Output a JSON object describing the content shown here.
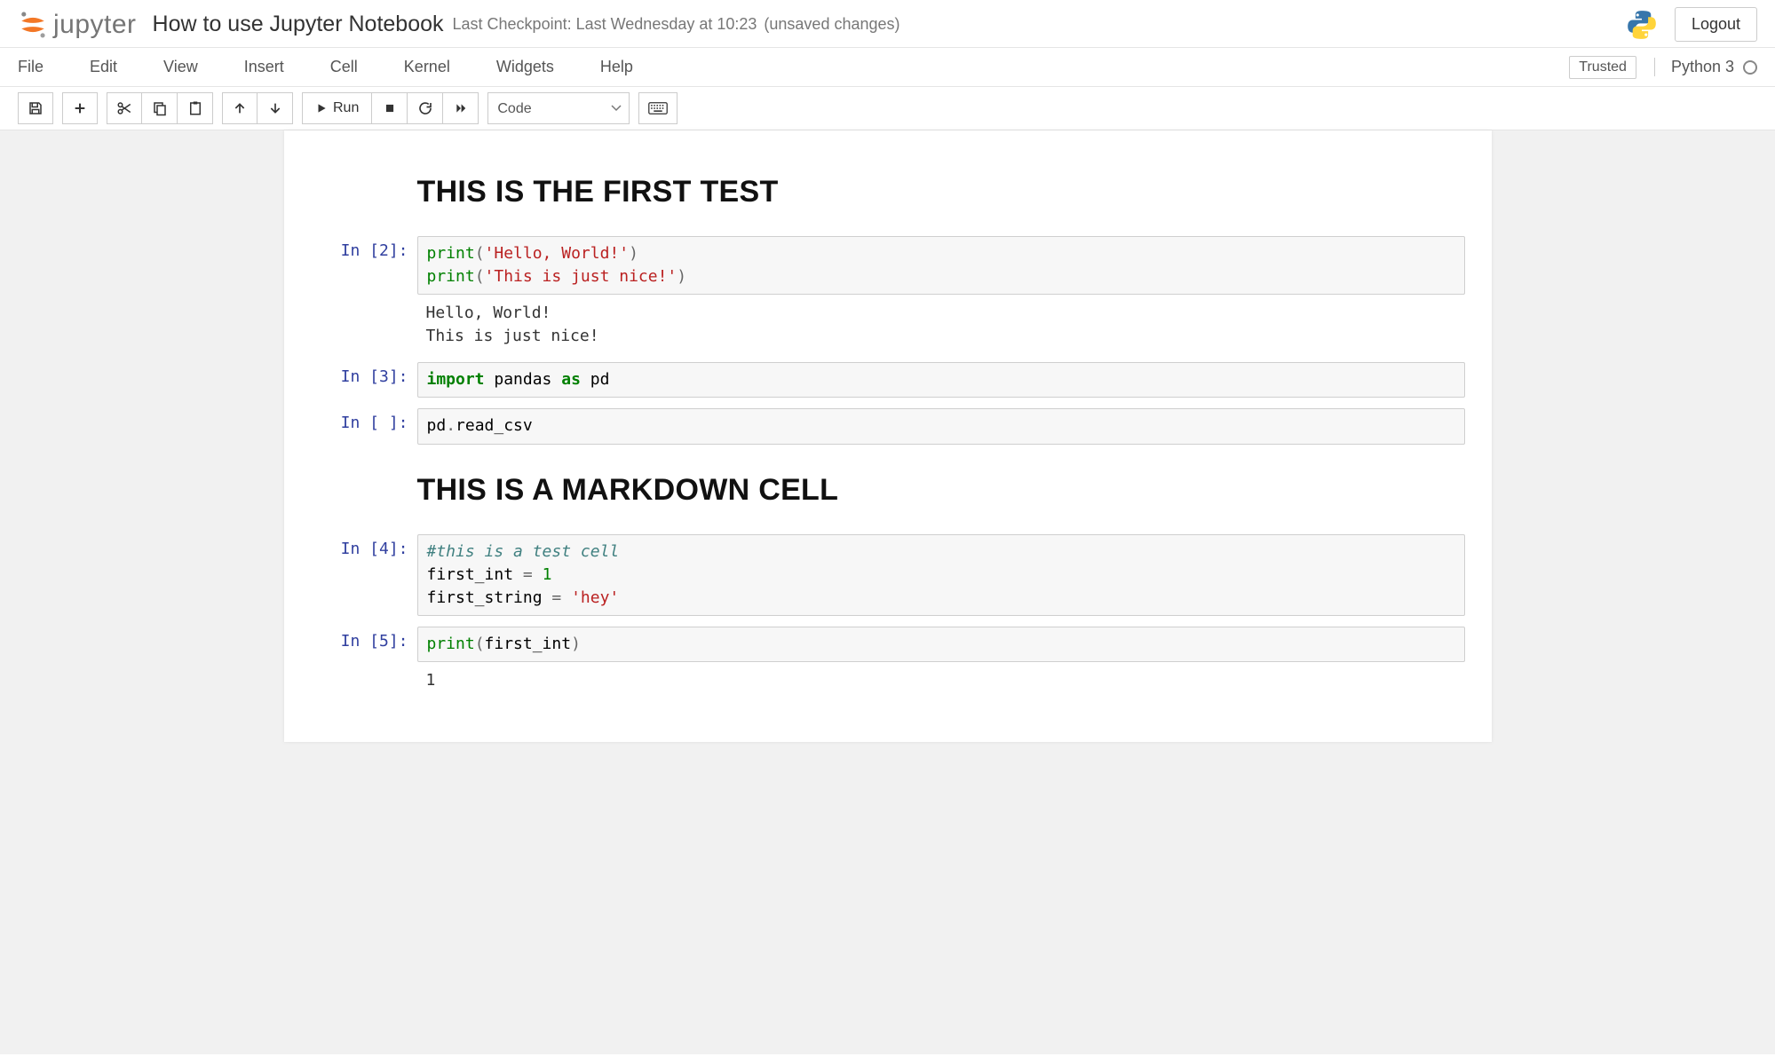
{
  "header": {
    "logo_text": "jupyter",
    "notebook_title": "How to use Jupyter Notebook",
    "checkpoint": "Last Checkpoint: Last Wednesday at 10:23",
    "unsaved": "(unsaved changes)",
    "logout": "Logout"
  },
  "menubar": {
    "items": [
      "File",
      "Edit",
      "View",
      "Insert",
      "Cell",
      "Kernel",
      "Widgets",
      "Help"
    ],
    "trusted": "Trusted",
    "kernel_name": "Python 3"
  },
  "toolbar": {
    "run_label": "Run",
    "cell_type_selected": "Code",
    "icons": {
      "save": "save-icon",
      "add": "plus-icon",
      "cut": "scissors-icon",
      "copy": "copy-icon",
      "paste": "paste-icon",
      "up": "arrow-up-icon",
      "down": "arrow-down-icon",
      "run": "play-icon",
      "stop": "stop-icon",
      "restart": "refresh-icon",
      "restart_run": "fast-forward-icon",
      "command_palette": "keyboard-icon"
    }
  },
  "cells": [
    {
      "type": "markdown",
      "rendered_heading": "THIS IS THE FIRST TEST"
    },
    {
      "type": "code",
      "prompt": "In [2]:",
      "source_tokens": [
        {
          "t": "builtin",
          "v": "print"
        },
        {
          "t": "op",
          "v": "("
        },
        {
          "t": "string",
          "v": "'Hello, World!'"
        },
        {
          "t": "op",
          "v": ")"
        },
        {
          "t": "nl"
        },
        {
          "t": "builtin",
          "v": "print"
        },
        {
          "t": "op",
          "v": "("
        },
        {
          "t": "string",
          "v": "'This is just nice!'"
        },
        {
          "t": "op",
          "v": ")"
        }
      ],
      "output": "Hello, World!\nThis is just nice!"
    },
    {
      "type": "code",
      "prompt": "In [3]:",
      "source_tokens": [
        {
          "t": "keyword",
          "v": "import"
        },
        {
          "t": "sp"
        },
        {
          "t": "name",
          "v": "pandas"
        },
        {
          "t": "sp"
        },
        {
          "t": "keyword",
          "v": "as"
        },
        {
          "t": "sp"
        },
        {
          "t": "name",
          "v": "pd"
        }
      ]
    },
    {
      "type": "code",
      "prompt": "In [ ]:",
      "source_tokens": [
        {
          "t": "name",
          "v": "pd"
        },
        {
          "t": "op",
          "v": "."
        },
        {
          "t": "name",
          "v": "read_csv"
        }
      ]
    },
    {
      "type": "markdown",
      "rendered_heading": "THIS IS A MARKDOWN CELL"
    },
    {
      "type": "code",
      "prompt": "In [4]:",
      "source_tokens": [
        {
          "t": "comment",
          "v": "#this is a test cell"
        },
        {
          "t": "nl"
        },
        {
          "t": "name",
          "v": "first_int"
        },
        {
          "t": "sp"
        },
        {
          "t": "op",
          "v": "="
        },
        {
          "t": "sp"
        },
        {
          "t": "number",
          "v": "1"
        },
        {
          "t": "nl"
        },
        {
          "t": "name",
          "v": "first_string"
        },
        {
          "t": "sp"
        },
        {
          "t": "op",
          "v": "="
        },
        {
          "t": "sp"
        },
        {
          "t": "string",
          "v": "'hey'"
        }
      ]
    },
    {
      "type": "code",
      "prompt": "In [5]:",
      "source_tokens": [
        {
          "t": "builtin",
          "v": "print"
        },
        {
          "t": "op",
          "v": "("
        },
        {
          "t": "name",
          "v": "first_int"
        },
        {
          "t": "op",
          "v": ")"
        }
      ],
      "output": "1"
    }
  ]
}
